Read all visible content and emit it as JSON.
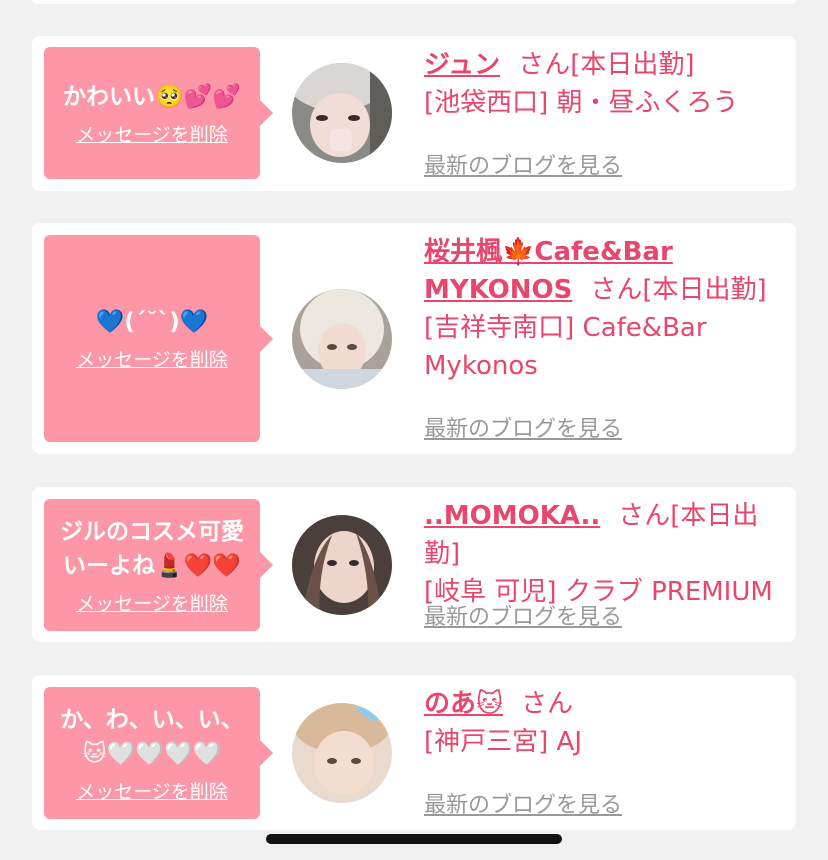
{
  "delete_label": "メッセージを削除",
  "blog_label": "最新のブログを見る",
  "cards": [
    {
      "message": "かわいい🥺💕💕",
      "name": "ジュン",
      "suffix": "さん[本日出勤]",
      "shop": "[池袋西口] 朝・昼ふくろう"
    },
    {
      "message": "💙(ˊ˘ˋ)💙",
      "name": "桜井楓🍁Cafe&Bar MYKONOS",
      "suffix": "さん[本日出勤]",
      "shop": "[吉祥寺南口] Cafe&Bar Mykonos"
    },
    {
      "message": "ジルのコスメ可愛いーよね💄❤️❤️",
      "name": "..MOMOKA..",
      "suffix": "さん[本日出勤]",
      "shop": "[岐阜 可児] クラブ PREMIUM"
    },
    {
      "message": "か、わ、い、い、🐱🤍🤍🤍🤍",
      "name": "のあ🐱",
      "suffix": "さん",
      "shop": "[神戸三宮] AJ"
    }
  ],
  "colors": {
    "accent": "#e8466c",
    "bubble": "#fd97a7",
    "link_gray": "#999999",
    "background": "#f1f1f1"
  }
}
